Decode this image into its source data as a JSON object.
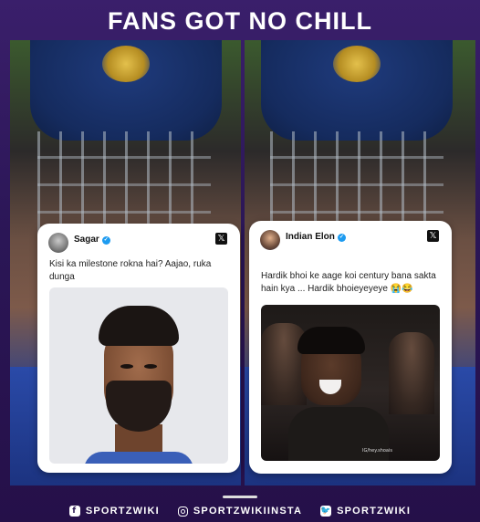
{
  "header": {
    "title": "FANS GOT NO CHILL"
  },
  "tweets": [
    {
      "username": "Sagar",
      "verified": true,
      "text": "Kisi ka milestone rokna hai? Aajao, ruka dunga",
      "media_description": "portrait of bearded man in blue jersey"
    },
    {
      "username": "Indian Elon",
      "verified": true,
      "text": "Hardik bhoi ke aage koi century bana sakta hain kya ... Hardik bhoieyeyeye 😭😂",
      "media_watermark": "IG/hey.shoais"
    }
  ],
  "footer": {
    "items": [
      {
        "icon": "facebook-icon",
        "label": "SPORTZWIKI"
      },
      {
        "icon": "instagram-icon",
        "label": "SPORTZWIKIINSTA"
      },
      {
        "icon": "twitter-icon",
        "label": "SPORTZWIKI"
      }
    ]
  },
  "colors": {
    "background": "#2a1752",
    "verified_badge": "#1d9bf0",
    "jersey_blue": "#2a4aa8"
  }
}
